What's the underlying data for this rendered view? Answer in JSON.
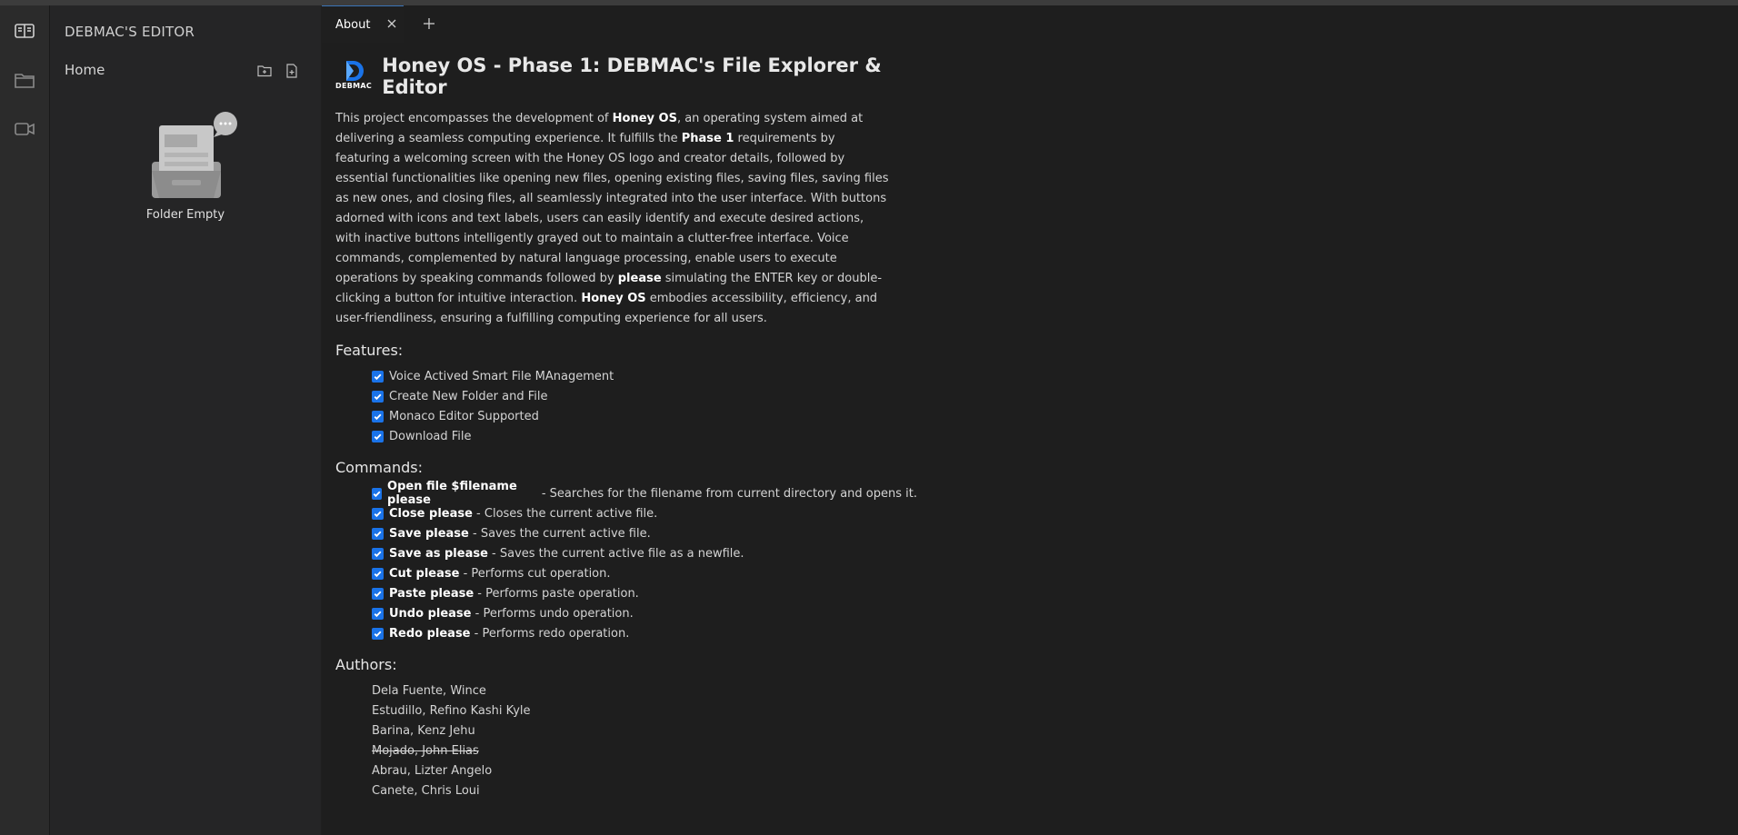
{
  "sidebar": {
    "title": "DEBMAC'S EDITOR",
    "home_label": "Home",
    "empty_label": "Folder Empty"
  },
  "tabs": [
    {
      "label": "About"
    }
  ],
  "about": {
    "logo_text": "DEBMAC",
    "title": "Honey OS - Phase 1: DEBMAC's File Explorer & Editor",
    "paragraph": [
      {
        "t": "This project encompasses the development of "
      },
      {
        "t": "Honey OS",
        "b": true
      },
      {
        "t": ", an operating system aimed at delivering a seamless computing experience. It fulfills the "
      },
      {
        "t": "Phase 1",
        "b": true
      },
      {
        "t": " requirements by featuring a welcoming screen with the Honey OS logo and creator details, followed by essential functionalities like opening new files, opening existing files, saving files, saving files as new ones, and closing files, all seamlessly integrated into the user interface. With buttons adorned with icons and text labels, users can easily identify and execute desired actions, with inactive buttons intelligently grayed out to maintain a clutter-free interface. Voice commands, complemented by natural language processing, enable users to execute operations by speaking commands followed by "
      },
      {
        "t": "please",
        "b": true
      },
      {
        "t": " simulating the ENTER key or double-clicking a button for intuitive interaction. "
      },
      {
        "t": "Honey OS",
        "b": true
      },
      {
        "t": " embodies accessibility, efficiency, and user-friendliness, ensuring a fulfilling computing experience for all users."
      }
    ],
    "features_heading": "Features:",
    "features": [
      "Voice Actived Smart File MAnagement",
      "Create New Folder and File",
      "Monaco Editor Supported",
      "Download File"
    ],
    "commands_heading": "Commands:",
    "commands": [
      {
        "cmd": "Open file $filename please",
        "desc": " - Searches for the filename from current directory and opens it."
      },
      {
        "cmd": "Close please",
        "desc": " - Closes the current active file."
      },
      {
        "cmd": "Save please",
        "desc": " - Saves the current active file."
      },
      {
        "cmd": "Save as please",
        "desc": " - Saves the current active file as a newfile."
      },
      {
        "cmd": "Cut please",
        "desc": " - Performs cut operation."
      },
      {
        "cmd": "Paste please",
        "desc": " - Performs paste operation."
      },
      {
        "cmd": "Undo please",
        "desc": " - Performs undo operation."
      },
      {
        "cmd": "Redo please",
        "desc": " - Performs redo operation."
      }
    ],
    "authors_heading": "Authors:",
    "authors": [
      {
        "name": "Dela Fuente, Wince"
      },
      {
        "name": "Estudillo, Refino Kashi Kyle"
      },
      {
        "name": "Barina, Kenz Jehu"
      },
      {
        "name": "Mojado, John Elias",
        "strike": true
      },
      {
        "name": "Abrau, Lizter Angelo"
      },
      {
        "name": "Canete, Chris Loui"
      }
    ]
  },
  "colors": {
    "accent": "#1a73e8",
    "background": "#1f1f1f",
    "sidebar": "#252526",
    "activity_bar": "#2b2b2b"
  },
  "icons": {
    "activity": [
      "book-icon",
      "folder-icon",
      "video-icon"
    ],
    "sidebar_actions": [
      "new-folder-icon",
      "new-file-icon"
    ],
    "tab_close": "close-icon",
    "tab_add": "plus-icon"
  }
}
